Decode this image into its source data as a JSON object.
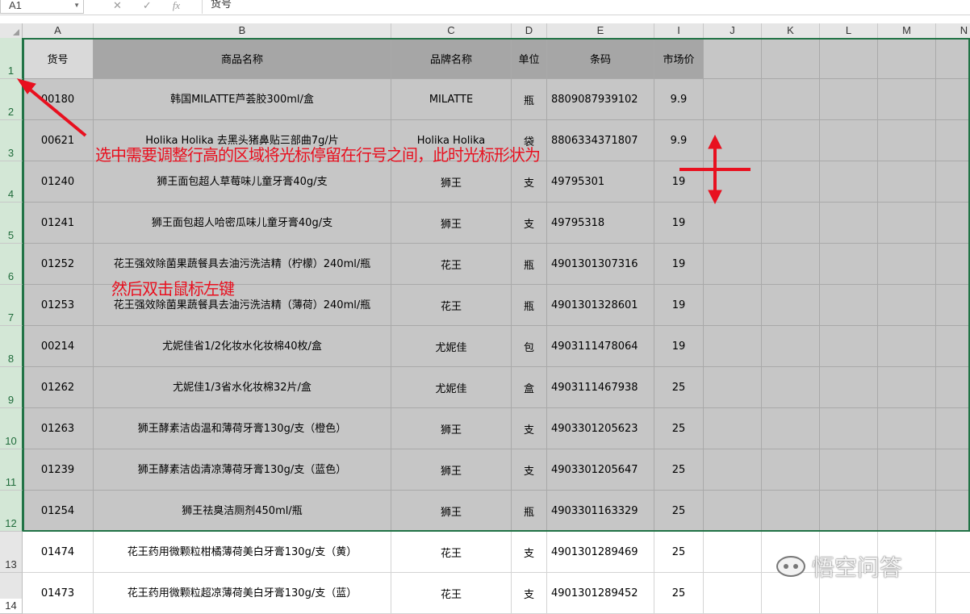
{
  "formula_bar": {
    "name_box": "A1",
    "cancel_icon": "✕",
    "enter_icon": "✓",
    "fx_label": "fx",
    "content": "货号"
  },
  "columns": [
    "A",
    "B",
    "C",
    "D",
    "E",
    "I",
    "J",
    "K",
    "L",
    "M",
    "N"
  ],
  "rows": [
    {
      "num": "1",
      "sel": true,
      "cells": [
        "货号",
        "商品名称",
        "品牌名称",
        "单位",
        "条码",
        "市场价"
      ]
    },
    {
      "num": "2",
      "sel": true,
      "cells": [
        "00180",
        "韩国MILATTE芦荟胶300ml/盒",
        "MILATTE",
        "瓶",
        "8809087939102",
        "9.9"
      ]
    },
    {
      "num": "3",
      "sel": true,
      "cells": [
        "00621",
        "Holika Holika 去黑头猪鼻贴三部曲7g/片",
        "Holika Holika",
        "袋",
        "8806334371807",
        "9.9"
      ]
    },
    {
      "num": "4",
      "sel": true,
      "cells": [
        "01240",
        "狮王面包超人草莓味儿童牙膏40g/支",
        "狮王",
        "支",
        "49795301",
        "19"
      ]
    },
    {
      "num": "5",
      "sel": true,
      "cells": [
        "01241",
        "狮王面包超人哈密瓜味儿童牙膏40g/支",
        "狮王",
        "支",
        "49795318",
        "19"
      ]
    },
    {
      "num": "6",
      "sel": true,
      "cells": [
        "01252",
        "花王强效除菌果蔬餐具去油污洗洁精（柠檬）240ml/瓶",
        "花王",
        "瓶",
        "4901301307316",
        "19"
      ]
    },
    {
      "num": "7",
      "sel": true,
      "cells": [
        "01253",
        "花王强效除菌果蔬餐具去油污洗洁精（薄荷）240ml/瓶",
        "花王",
        "瓶",
        "4901301328601",
        "19"
      ]
    },
    {
      "num": "8",
      "sel": true,
      "cells": [
        "00214",
        "尤妮佳省1/2化妆水化妆棉40枚/盒",
        "尤妮佳",
        "包",
        "4903111478064",
        "19"
      ]
    },
    {
      "num": "9",
      "sel": true,
      "cells": [
        "01262",
        "尤妮佳1/3省水化妆棉32片/盒",
        "尤妮佳",
        "盒",
        "4903111467938",
        "25"
      ]
    },
    {
      "num": "10",
      "sel": true,
      "cells": [
        "01263",
        "狮王酵素洁齿温和薄荷牙膏130g/支（橙色）",
        "狮王",
        "支",
        "4903301205623",
        "25"
      ]
    },
    {
      "num": "11",
      "sel": true,
      "cells": [
        "01239",
        "狮王酵素洁齿清凉薄荷牙膏130g/支（蓝色）",
        "狮王",
        "支",
        "4903301205647",
        "25"
      ]
    },
    {
      "num": "12",
      "sel": true,
      "cells": [
        "01254",
        "狮王祛臭洁厕剂450ml/瓶",
        "狮王",
        "瓶",
        "4903301163329",
        "25"
      ]
    },
    {
      "num": "13",
      "sel": false,
      "cells": [
        "01474",
        "花王药用微颗粒柑橘薄荷美白牙膏130g/支（黄）",
        "花王",
        "支",
        "4901301289469",
        "25"
      ]
    },
    {
      "num": "14",
      "sel": false,
      "cells": [
        "01473",
        "花王药用微颗粒超凉薄荷美白牙膏130g/支（蓝）",
        "花王",
        "支",
        "4901301289452",
        "25"
      ]
    }
  ],
  "annotations": {
    "step1": "选中需要调整行高的区域将光标停留在行号之间，此时光标形状为",
    "step2": "然后双击鼠标左键"
  },
  "watermark": "悟空问答",
  "colors": {
    "annotation": "#e8101f",
    "selection_border": "#217346",
    "selected_fill": "#c6c6c6",
    "header_gray": "#a6a6a6"
  }
}
